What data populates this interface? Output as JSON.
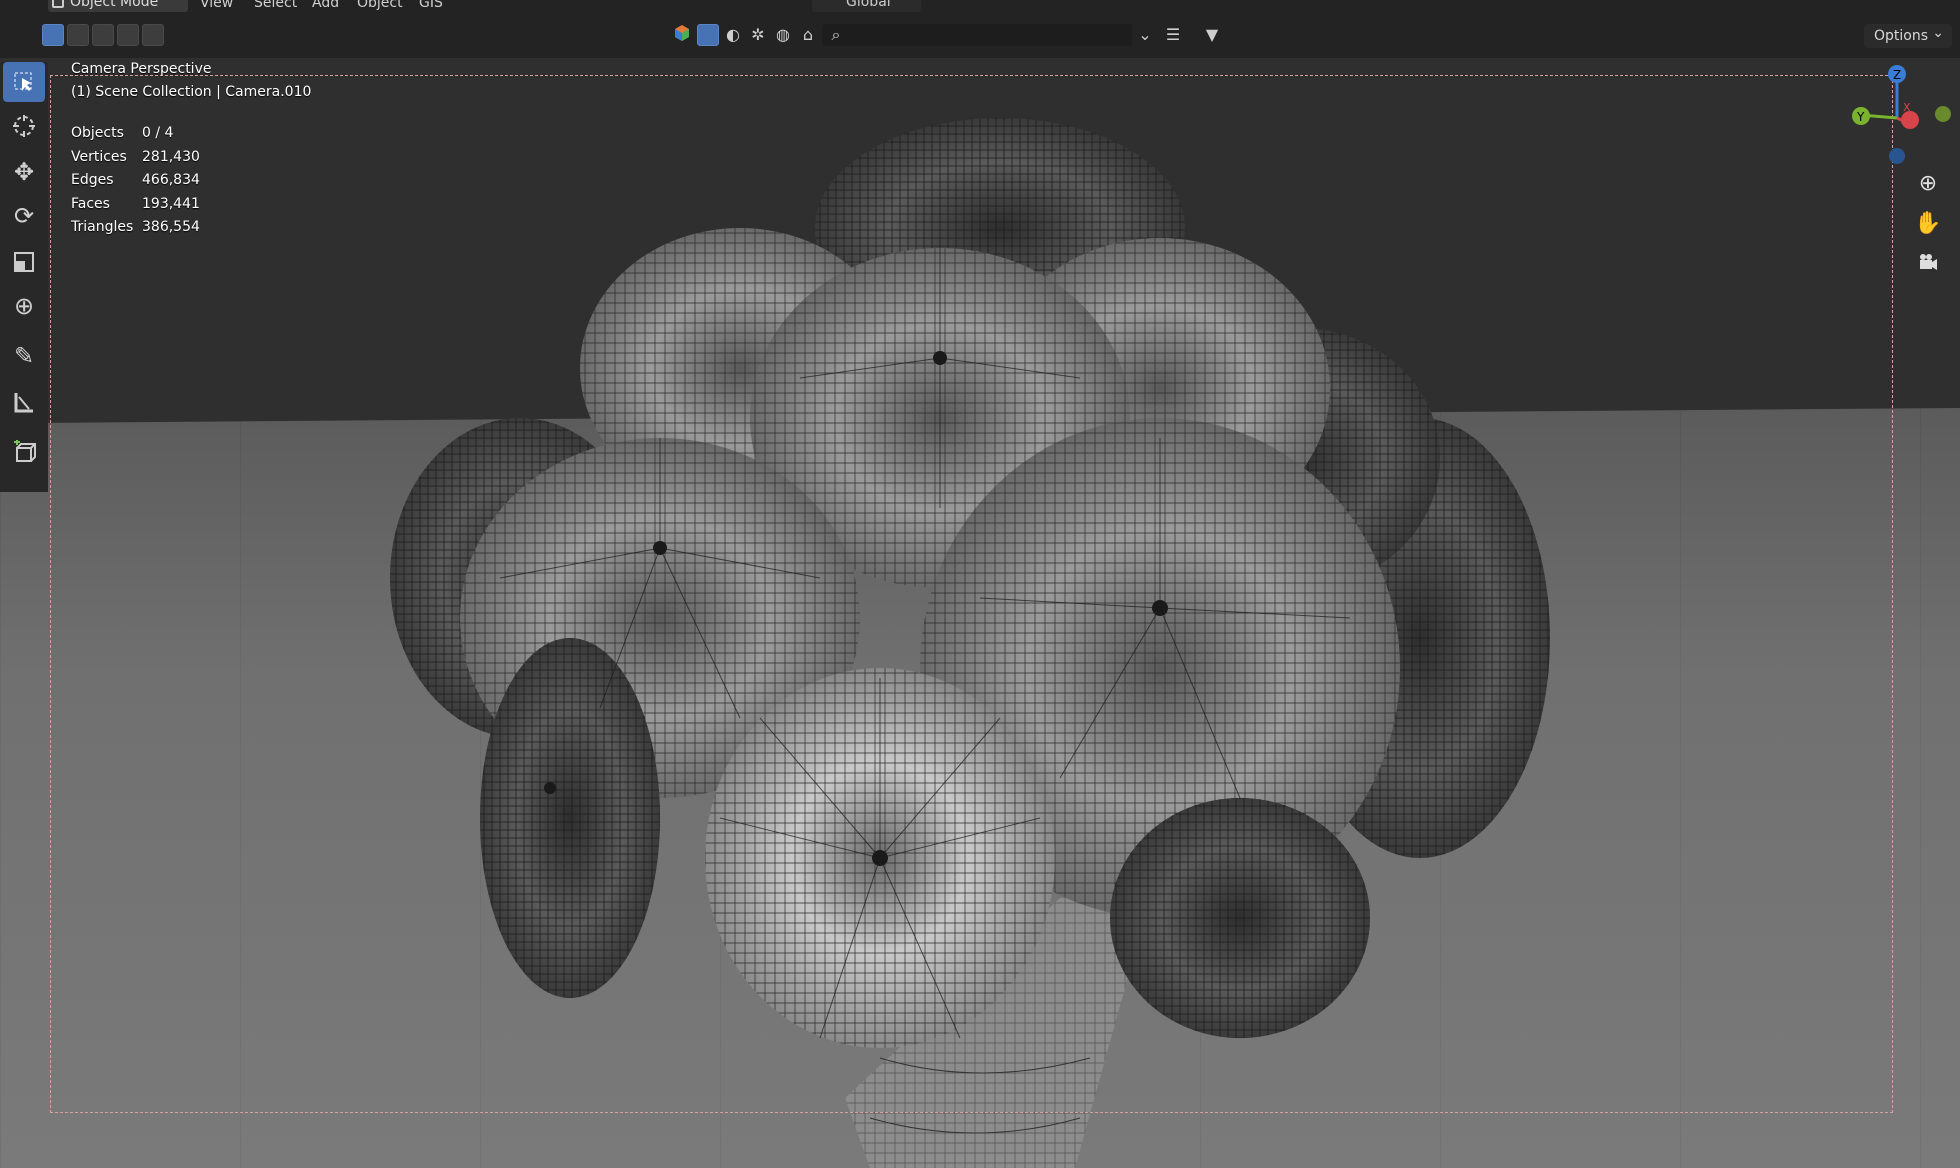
{
  "header": {
    "mode_label": "Object Mode",
    "menu": [
      "View",
      "Select",
      "Add",
      "Object",
      "GIS"
    ],
    "orientation_label": "Global",
    "options_label": "Options"
  },
  "viewport": {
    "title": "Camera Perspective",
    "collection_line": "(1) Scene Collection | Camera.010",
    "stats": [
      {
        "label": "Objects",
        "value": "0 / 4"
      },
      {
        "label": "Vertices",
        "value": "281,430"
      },
      {
        "label": "Edges",
        "value": "466,834"
      },
      {
        "label": "Faces",
        "value": "193,441"
      },
      {
        "label": "Triangles",
        "value": "386,554"
      }
    ]
  },
  "gizmo": {
    "axis_z": "Z",
    "axis_y": "Y",
    "axis_x": "X",
    "colors": {
      "x": "#d9434c",
      "y": "#7ab32e",
      "z": "#3a7dd6"
    }
  },
  "icons": {
    "tools": [
      "select-box-icon",
      "cursor-icon",
      "move-icon",
      "rotate-icon",
      "scale-icon",
      "transform-icon",
      "annotate-icon",
      "measure-icon",
      "add-cube-icon"
    ],
    "nav": [
      "zoom-icon",
      "hand-pan-icon",
      "camera-view-icon"
    ]
  }
}
